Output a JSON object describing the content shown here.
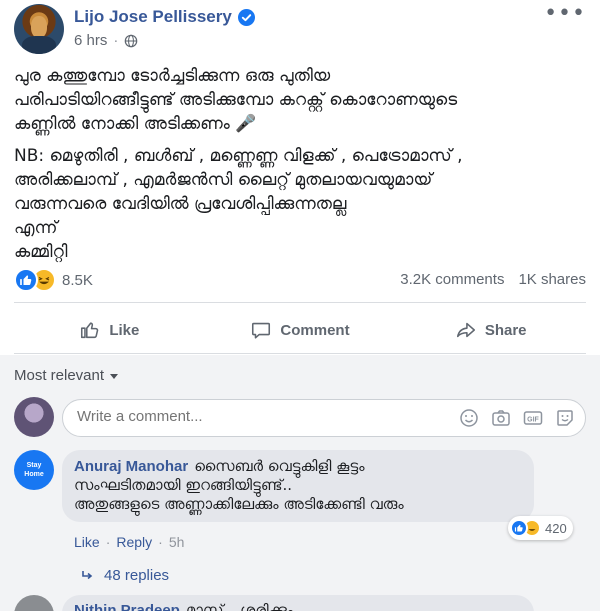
{
  "post": {
    "author": "Lijo Jose Pellissery",
    "time": "6 hrs",
    "dot": "·",
    "more": "•••",
    "paragraph1": "പുര കത്തുമ്പോ ടോർച്ചടിക്കുന്ന ഒരു പുതിയ\nപരിപാടിയിറങ്ങീട്ടുണ്ട് അടിക്കുമ്പോ കറക്റ്റ് കൊറോണയുടെ\nകണ്ണിൽ നോക്കി അടിക്കണം 🎤",
    "paragraph2": "NB: മെഴുതിരി , ബൾബ് , മണ്ണെണ്ണ വിളക്ക് , പെട്രോമാസ് ,\nഅരിക്കലാമ്പ് , എമർജൻസി ലൈറ്റ് മുതലായവയുമായ്\nവരുന്നവരെ വേദിയിൽ പ്രവേശിപ്പിക്കുന്നതല്ല\nഎന്ന്\nകമ്മിറ്റി"
  },
  "counts": {
    "reactions": "8.5K",
    "comments": "3.2K comments",
    "shares": "1K shares"
  },
  "actions": {
    "like": "Like",
    "comment": "Comment",
    "share": "Share"
  },
  "comments": {
    "sort_label": "Most relevant",
    "composer_placeholder": "Write a comment...",
    "items": [
      {
        "avatar_text": "Stay\nHome",
        "author": "Anuraj Manohar",
        "text": "സൈബർ വെട്ടുകിളി കൂട്ടം\nസംഘടിതമായി ഇറങ്ങിയിട്ടുണ്ട്..\nഅതുങ്ങളുടെ അണ്ണാക്കിലേക്കും അടിക്കേണ്ടി വരും",
        "reaction_count": "420",
        "like": "Like",
        "reply": "Reply",
        "sep": "·",
        "time": "5h",
        "replies": "48 replies"
      }
    ],
    "next_author": "Nithin Pradeep",
    "next_text": "മാസ്ക് ...ശരിക്കും..."
  },
  "colors": {
    "link": "#385898",
    "like_blue": "#1877f2",
    "haha_yellow": "#f7b928",
    "comment_bg": "#f2f3f5"
  },
  "icons": {
    "verified": "verified-badge-icon",
    "globe": "globe-icon",
    "like": "thumbs-up-icon",
    "comment": "speech-bubble-icon",
    "share": "share-arrow-icon",
    "emoji": "smiley-icon",
    "camera": "camera-icon",
    "gif": "gif-icon",
    "sticker": "sticker-icon"
  }
}
